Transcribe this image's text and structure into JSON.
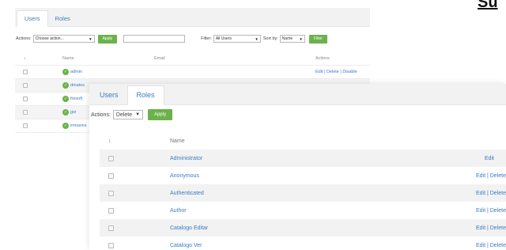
{
  "corner_title": "Su",
  "users_panel": {
    "tabs": [
      {
        "label": "Users"
      },
      {
        "label": "Roles"
      }
    ],
    "actions_label": "Actions:",
    "actions_select": "Choose action...",
    "apply_label": "Apply",
    "filter_label": "Filter:",
    "filter_select": "All Users",
    "sort_label": "Sort by:",
    "sort_select": "Name",
    "filter_button": "Filter",
    "columns": {
      "sort": "↕",
      "name": "Name",
      "email": "Email",
      "actions": "Actions"
    },
    "rows": [
      {
        "name": "admin",
        "actions": "Edit | Delete | Disable"
      },
      {
        "name": "dmatos",
        "actions": ""
      },
      {
        "name": "fresoft",
        "actions": ""
      },
      {
        "name": "gsr",
        "actions": ""
      },
      {
        "name": "imnaves",
        "actions": ""
      }
    ]
  },
  "roles_panel": {
    "tabs": [
      {
        "label": "Users"
      },
      {
        "label": "Roles"
      }
    ],
    "actions_label": "Actions:",
    "actions_select": "Delete",
    "apply_label": "Apply",
    "columns": {
      "sort": "↕",
      "name": "Name"
    },
    "rows": [
      {
        "name": "Administrator",
        "actions": "Edit"
      },
      {
        "name": "Anonymous",
        "actions": "Edit | Delete"
      },
      {
        "name": "Authenticated",
        "actions": "Edit | Delete"
      },
      {
        "name": "Author",
        "actions": "Edit | Delete"
      },
      {
        "name": "Catalogo Editar",
        "actions": "Edit | Delete"
      },
      {
        "name": "Catalogo Ver",
        "actions": "Edit | Delete"
      }
    ]
  },
  "colors": {
    "accent": "#3a7cc4",
    "apply_green": "#6bb24a"
  },
  "icons": {
    "user_status": "check-circle-icon",
    "caret": "chevron-down-icon"
  }
}
